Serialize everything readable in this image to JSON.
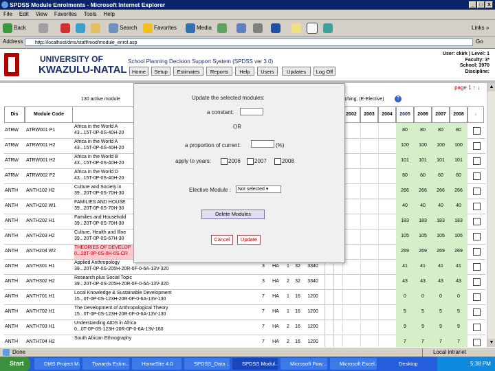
{
  "window": {
    "title": "SPDSS Module Enrolments - Microsoft Internet Explorer",
    "min": "_",
    "max": "□",
    "close": "X"
  },
  "menu": [
    "File",
    "Edit",
    "View",
    "Favorites",
    "Tools",
    "Help"
  ],
  "toolbar": {
    "back": "Back",
    "search": "Search",
    "favorites": "Favorites",
    "media": "Media",
    "links": "Links"
  },
  "address": {
    "label": "Address",
    "url": "http://localhost/dms/staff/mod/module_enrol.asp",
    "go": "Go"
  },
  "header": {
    "university_line1": "UNIVERSITY OF",
    "university_line2": "KWAZULU-NATAL",
    "system_name": "School Planning Decision Support System (SPDSS ver 3.0)",
    "nav": [
      "Home",
      "Setup",
      "Estimates",
      "Reports",
      "Help",
      "Users",
      "Updates",
      "Log Off"
    ],
    "user": [
      "User: ckirk | Level: 1",
      "Faculty: 3*",
      "School: 3970",
      "Discipline:"
    ]
  },
  "page": {
    "page_link": "page 1",
    "info_left": "130 active module",
    "info_right": "teaching, (E-Elective)",
    "help": "?"
  },
  "table": {
    "headers": {
      "dis": "Dis",
      "code": "Module Code",
      "years": [
        "2002",
        "2003",
        "2004",
        "2005",
        "2006",
        "2007",
        "2008"
      ],
      "sort": "↓"
    },
    "rows": [
      {
        "dis": "ATRW",
        "code": "ATRW001 P1",
        "title": "Africa in the World A",
        "sub": "43...15T-0P-0S-40H-20",
        "extra": [
          "",
          "",
          "",
          ""
        ],
        "vals": [
          "80",
          "80",
          "80",
          "80"
        ]
      },
      {
        "dis": "ATRW",
        "code": "ATRW001 H2",
        "title": "Africa in the World A",
        "sub": "43...15T-0P-0S-40H-20",
        "extra": [
          "",
          "",
          "",
          ""
        ],
        "vals": [
          "100",
          "100",
          "100",
          "100"
        ]
      },
      {
        "dis": "ATRW",
        "code": "ATRW001 H2",
        "title": "Africa in the World B",
        "sub": "43...15T-0P-0S-40H-20",
        "extra": [
          "",
          "",
          "",
          ""
        ],
        "vals": [
          "101",
          "101",
          "101",
          "101"
        ]
      },
      {
        "dis": "ATRW",
        "code": "ATRW002 P2",
        "title": "Africa in the World D",
        "sub": "43...15T-0P-0S-40H-20",
        "extra": [
          "",
          "",
          "",
          ""
        ],
        "vals": [
          "60",
          "60",
          "60",
          "60"
        ]
      },
      {
        "dis": "ANTH",
        "code": "ANTH102 H2",
        "title": "Culture and Society in",
        "sub": "39...20T-0P-0S-70H-30",
        "extra": [
          "",
          "",
          "",
          ""
        ],
        "vals": [
          "266",
          "266",
          "266",
          "266"
        ]
      },
      {
        "dis": "ANTH",
        "code": "ANTH202 W1",
        "title": "FAMILIES AND HOUSE",
        "sub": "39...20T-0P-0S-70H-30",
        "extra": [
          "",
          "",
          "",
          ""
        ],
        "vals": [
          "40",
          "40",
          "40",
          "40"
        ]
      },
      {
        "dis": "ANTH",
        "code": "ANTH202 H1",
        "title": "Families and Household",
        "sub": "39...20T-0P-0S-70H-30",
        "extra": [
          "",
          "",
          "",
          ""
        ],
        "vals": [
          "183",
          "183",
          "183",
          "183"
        ]
      },
      {
        "dis": "ANTH",
        "code": "ANTH203 H2",
        "title": "Culture, Health and Illne",
        "sub": "39...20T-0P-0S-67H-30",
        "extra": [
          "",
          "",
          "",
          ""
        ],
        "vals": [
          "105",
          "105",
          "105",
          "105"
        ]
      },
      {
        "dis": "ANTH",
        "code": "ANTH204 W2",
        "title": "THEORIES OF DEVELOP",
        "sub": "0...20T-0P-0S-0H-0S-CR",
        "extra": [
          "",
          "",
          "",
          ""
        ],
        "vals": [
          "269",
          "269",
          "269",
          "269"
        ],
        "pink": true
      },
      {
        "dis": "ANTH",
        "code": "ANTH301 H1",
        "title": "Applied Anthropology",
        "sub": "39...20T-0P-0S-205H-20R-0F-0-6A-13V-320",
        "extra": [
          "3",
          "HA",
          "1",
          "32",
          "3340"
        ],
        "vals": [
          "41",
          "41",
          "41",
          "41"
        ]
      },
      {
        "dis": "ANTH",
        "code": "ANTH302 H2",
        "title": "Research plus Social Topic",
        "sub": "39...20T-0P-0S-205H-20R-0F-0-6A-13V-320",
        "extra": [
          "3",
          "HA",
          "2",
          "32",
          "3340"
        ],
        "vals": [
          "43",
          "43",
          "43",
          "43"
        ]
      },
      {
        "dis": "ANTH",
        "code": "ANTH701 H1",
        "title": "Local Knowledge & Sustainable Development",
        "sub": "15...0T-0P-0S-123H-20R-0F-0-6A-13V-130",
        "extra": [
          "7",
          "HA",
          "1",
          "16",
          "1200"
        ],
        "vals": [
          "0",
          "0",
          "0",
          "0"
        ]
      },
      {
        "dis": "ANTH",
        "code": "ANTH702 H1",
        "title": "The Development of Anthropological Theory",
        "sub": "15...0T-0P-0S-123H-20R-0F-0-6A-13V-130",
        "extra": [
          "7",
          "HA",
          "1",
          "16",
          "1200"
        ],
        "vals": [
          "5",
          "5",
          "5",
          "5"
        ]
      },
      {
        "dis": "ANTH",
        "code": "ANTH703 H1",
        "title": "Understanding AIDS in Africa",
        "sub": "0...0T-0P-0S-123H-20R-0F-0-6A-13V-160",
        "extra": [
          "7",
          "HA",
          "2",
          "16",
          "1200"
        ],
        "vals": [
          "9",
          "9",
          "9",
          "9"
        ]
      },
      {
        "dis": "ANTH",
        "code": "ANTH704 H2",
        "title": "South African Ethnography",
        "sub": "",
        "extra": [
          "7",
          "HA",
          "2",
          "16",
          "1200"
        ],
        "vals": [
          "7",
          "7",
          "7",
          "7"
        ]
      }
    ]
  },
  "modal": {
    "heading": "Update the selected modules:",
    "constant_label": "a constant:",
    "or": "OR",
    "proportion_label": "a proportion of current:",
    "percent": "(%)",
    "apply_label": "apply to years:",
    "years": [
      "2006",
      "2007",
      "2008"
    ],
    "elective_label": "Elective Module :",
    "elective_value": "Not selected",
    "delete_label": "Delete Modules",
    "cancel_label": "Cancel",
    "update_label": "Update"
  },
  "status": {
    "text": "Done",
    "zone": "Local intranet"
  },
  "taskbar": {
    "start": "Start",
    "tasks": [
      "DMS Project M...",
      "Towards Estim...",
      "HomeSite 4.0",
      "SPDSS_Data :...",
      "SPDSS Modul...",
      "Microsoft Pow...",
      "Microsoft Excel...",
      "Desktop"
    ],
    "clock": "5:38 PM"
  },
  "colors": {
    "brand_blue": "#1a2f6b",
    "green_cell": "#d5f0c9",
    "taskbar": "#245edc"
  }
}
